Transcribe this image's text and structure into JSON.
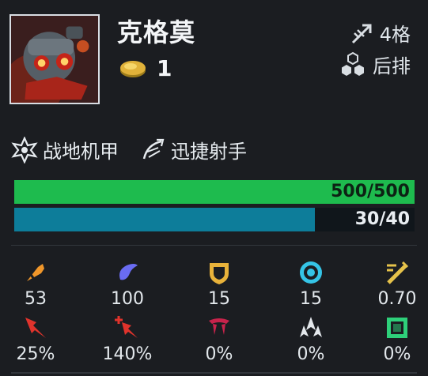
{
  "champion": {
    "name": "克格莫",
    "cost": "1",
    "range_label": "4格",
    "position_label": "后排",
    "portrait_icon": "kogmaw-portrait"
  },
  "traits": [
    {
      "label": "战地机甲",
      "icon": "battle-mech-icon"
    },
    {
      "label": "迅捷射手",
      "icon": "rapidfire-icon"
    }
  ],
  "health": {
    "text": "500/500",
    "current": 500,
    "max": 500,
    "color": "#1ebb4e"
  },
  "mana": {
    "text": "30/40",
    "current": 30,
    "max": 40,
    "color": "#0d7d9a"
  },
  "stats_row1": [
    {
      "icon": "attack-damage-icon",
      "value": "53",
      "color": "#f0962a"
    },
    {
      "icon": "ability-power-icon",
      "value": "100",
      "color": "#6a6cf2"
    },
    {
      "icon": "armor-icon",
      "value": "15",
      "color": "#e8b23a"
    },
    {
      "icon": "magic-resist-icon",
      "value": "15",
      "color": "#35c4e6"
    },
    {
      "icon": "attack-speed-icon",
      "value": "0.70",
      "color": "#e6c24a"
    }
  ],
  "stats_row2": [
    {
      "icon": "crit-chance-icon",
      "value": "25%",
      "color": "#e0332c"
    },
    {
      "icon": "crit-damage-icon",
      "value": "140%",
      "color": "#e0332c"
    },
    {
      "icon": "omnivamp-icon",
      "value": "0%",
      "color": "#c8234b"
    },
    {
      "icon": "damage-amp-icon",
      "value": "0%",
      "color": "#e4e8ec"
    },
    {
      "icon": "durability-icon",
      "value": "0%",
      "color": "#2ed07a"
    }
  ]
}
